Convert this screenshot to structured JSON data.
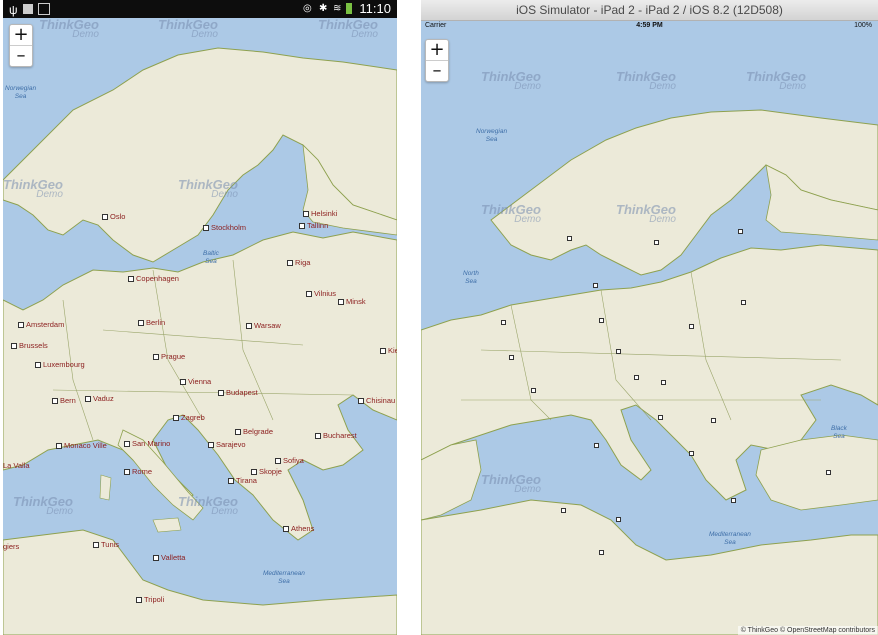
{
  "left_device": {
    "status_time": "11:10",
    "watermark": {
      "brand": "ThinkGeo",
      "sub": "Demo"
    },
    "zoom": {
      "in_label": "+",
      "out_label": "–"
    },
    "seas": [
      {
        "name": "norwegian",
        "label": "Norwegian\nSea"
      },
      {
        "name": "baltic",
        "label": "Baltic\nSea"
      },
      {
        "name": "mediterranean",
        "label": "Mediterranean\nSea"
      }
    ],
    "cities": [
      "Oslo",
      "Stockholm",
      "Helsinki",
      "Tallinn",
      "Riga",
      "Copenhagen",
      "Vilnius",
      "Minsk",
      "Amsterdam",
      "Berlin",
      "Warsaw",
      "Brussels",
      "Kiev",
      "Luxembourg",
      "Prague",
      "Vienna",
      "Budapest",
      "Bern",
      "Vaduz",
      "Chisinau",
      "Zagreb",
      "Belgrade",
      "Bucharest",
      "Sarajevo",
      "Monaco Ville",
      "San Marino",
      "Sofiya",
      "La Valla",
      "Rome",
      "Skopje",
      "Tirana",
      "Athens",
      "Tunis",
      "Valletta",
      "Tripoli",
      "giers"
    ]
  },
  "right_device": {
    "window_title": "iOS Simulator - iPad 2 - iPad 2 / iOS 8.2 (12D508)",
    "carrier": "Carrier",
    "clock": "4:59 PM",
    "battery": "100%",
    "zoom": {
      "in_label": "+",
      "out_label": "–"
    },
    "watermark": {
      "brand": "ThinkGeo",
      "sub": "Demo"
    },
    "seas": [
      {
        "name": "norwegian",
        "label": "Norwegian\nSea"
      },
      {
        "name": "north",
        "label": "North\nSea"
      },
      {
        "name": "black",
        "label": "Black\nSea"
      },
      {
        "name": "mediterranean",
        "label": "Mediterranean\nSea"
      }
    ],
    "attribution": "© ThinkGeo © OpenStreetMap contributors"
  },
  "colors": {
    "water": "#acc9e6",
    "land": "#ecead9",
    "border": "#8ea14f",
    "city_text": "#8b1d1d"
  }
}
